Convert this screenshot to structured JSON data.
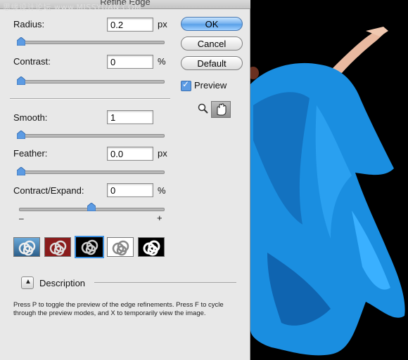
{
  "watermark": "思缘设计论坛 www.MISSYUAN.COM",
  "dialog": {
    "title": "Refine Edge",
    "radius": {
      "label": "Radius:",
      "value": "0.2",
      "unit": "px",
      "slider_level": 0.0
    },
    "contrast": {
      "label": "Contrast:",
      "value": "0",
      "unit": "%",
      "slider_level": 0.0
    },
    "smooth": {
      "label": "Smooth:",
      "value": "1",
      "slider_level": 0.0
    },
    "feather": {
      "label": "Feather:",
      "value": "0.0",
      "unit": "px",
      "slider_level": 0.0
    },
    "contract_expand": {
      "label": "Contract/Expand:",
      "value": "0",
      "unit": "%",
      "minus": "–",
      "plus": "+",
      "slider_level": 0.5
    },
    "buttons": {
      "ok": "OK",
      "cancel": "Cancel",
      "default": "Default"
    },
    "preview": {
      "label": "Preview",
      "checked": true
    },
    "preview_modes": [
      "standard",
      "quick-mask",
      "on-black",
      "on-white",
      "mask"
    ],
    "selected_mode": "on-black",
    "description": {
      "label": "Description",
      "text": "Press P to toggle the preview of the edge refinements. Press F to cycle through the preview modes, and X to temporarily view the image."
    },
    "tools": [
      "zoom-tool-icon",
      "hand-tool-icon"
    ]
  },
  "colors": {
    "accent": "#5aa0e8",
    "dress": "#1a8ee0",
    "background": "#000000"
  }
}
